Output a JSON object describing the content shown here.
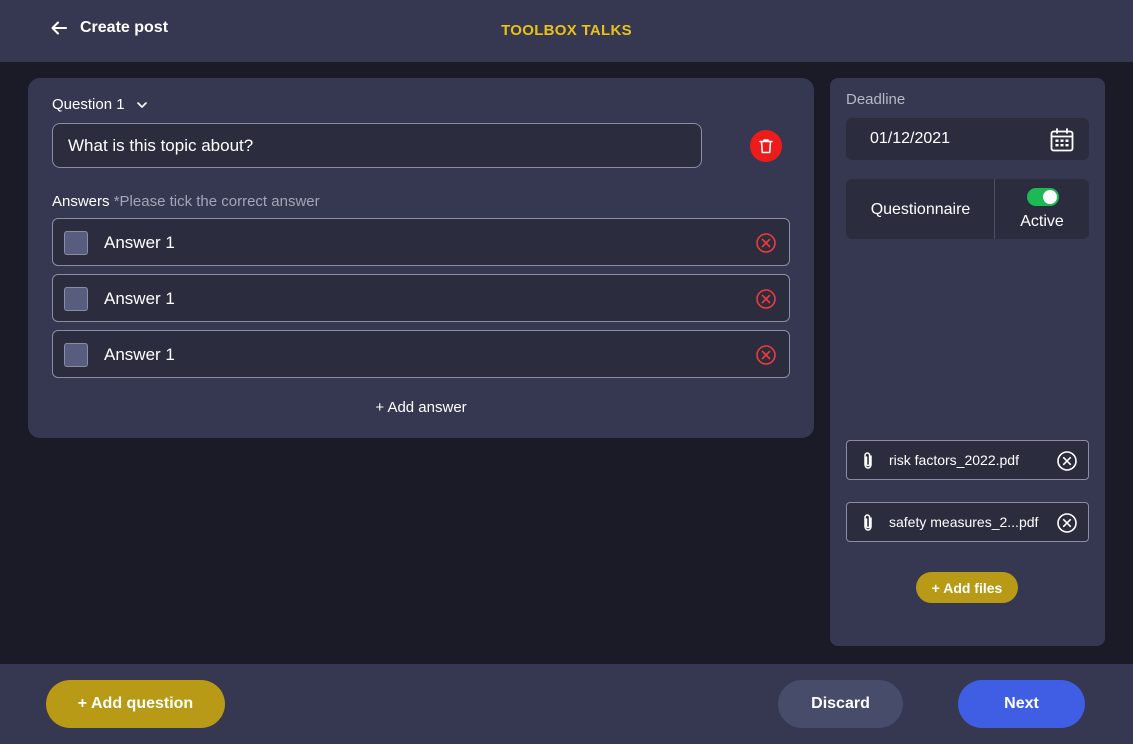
{
  "header": {
    "back_label": "Create post",
    "app_title": "TOOLBOX TALKS"
  },
  "question": {
    "header_label": "Question 1",
    "input_value": "What is this topic about?",
    "answers_label": "Answers",
    "answers_hint": "*Please tick the correct answer",
    "answers": [
      {
        "label": "Answer 1",
        "checked": false
      },
      {
        "label": "Answer 1",
        "checked": false
      },
      {
        "label": "Answer 1",
        "checked": false
      }
    ],
    "add_answer_label": "+ Add answer"
  },
  "sidebar": {
    "deadline_label": "Deadline",
    "deadline_value": "01/12/2021",
    "questionnaire_label": "Questionnaire",
    "status_label": "Active",
    "status_on": true,
    "files": [
      {
        "name": "risk factors_2022.pdf"
      },
      {
        "name": "safety measures_2...pdf"
      }
    ],
    "add_files_label": "+ Add files"
  },
  "footer": {
    "add_question_label": "+ Add question",
    "discard_label": "Discard",
    "next_label": "Next"
  },
  "colors": {
    "accent_yellow": "#e8c21a",
    "button_gold": "#b89a16",
    "primary_blue": "#3f5ee3",
    "danger_red": "#ee1b1b",
    "toggle_green": "#1db954"
  }
}
